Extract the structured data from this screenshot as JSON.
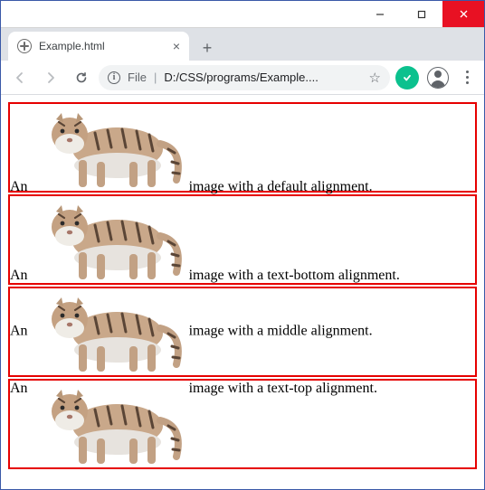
{
  "window": {
    "tab_title": "Example.html",
    "omnibox": {
      "scheme_label": "File",
      "path_display": "D:/CSS/programs/Example...."
    }
  },
  "rows": [
    {
      "pre": "An",
      "post": "image with a default alignment.",
      "valign": "baseline"
    },
    {
      "pre": "An",
      "post": "image with a text-bottom alignment.",
      "valign": "textbottom"
    },
    {
      "pre": "An",
      "post": "image with a middle alignment.",
      "valign": "middle"
    },
    {
      "pre": "An",
      "post": "image with a text-top alignment.",
      "valign": "texttop"
    }
  ]
}
